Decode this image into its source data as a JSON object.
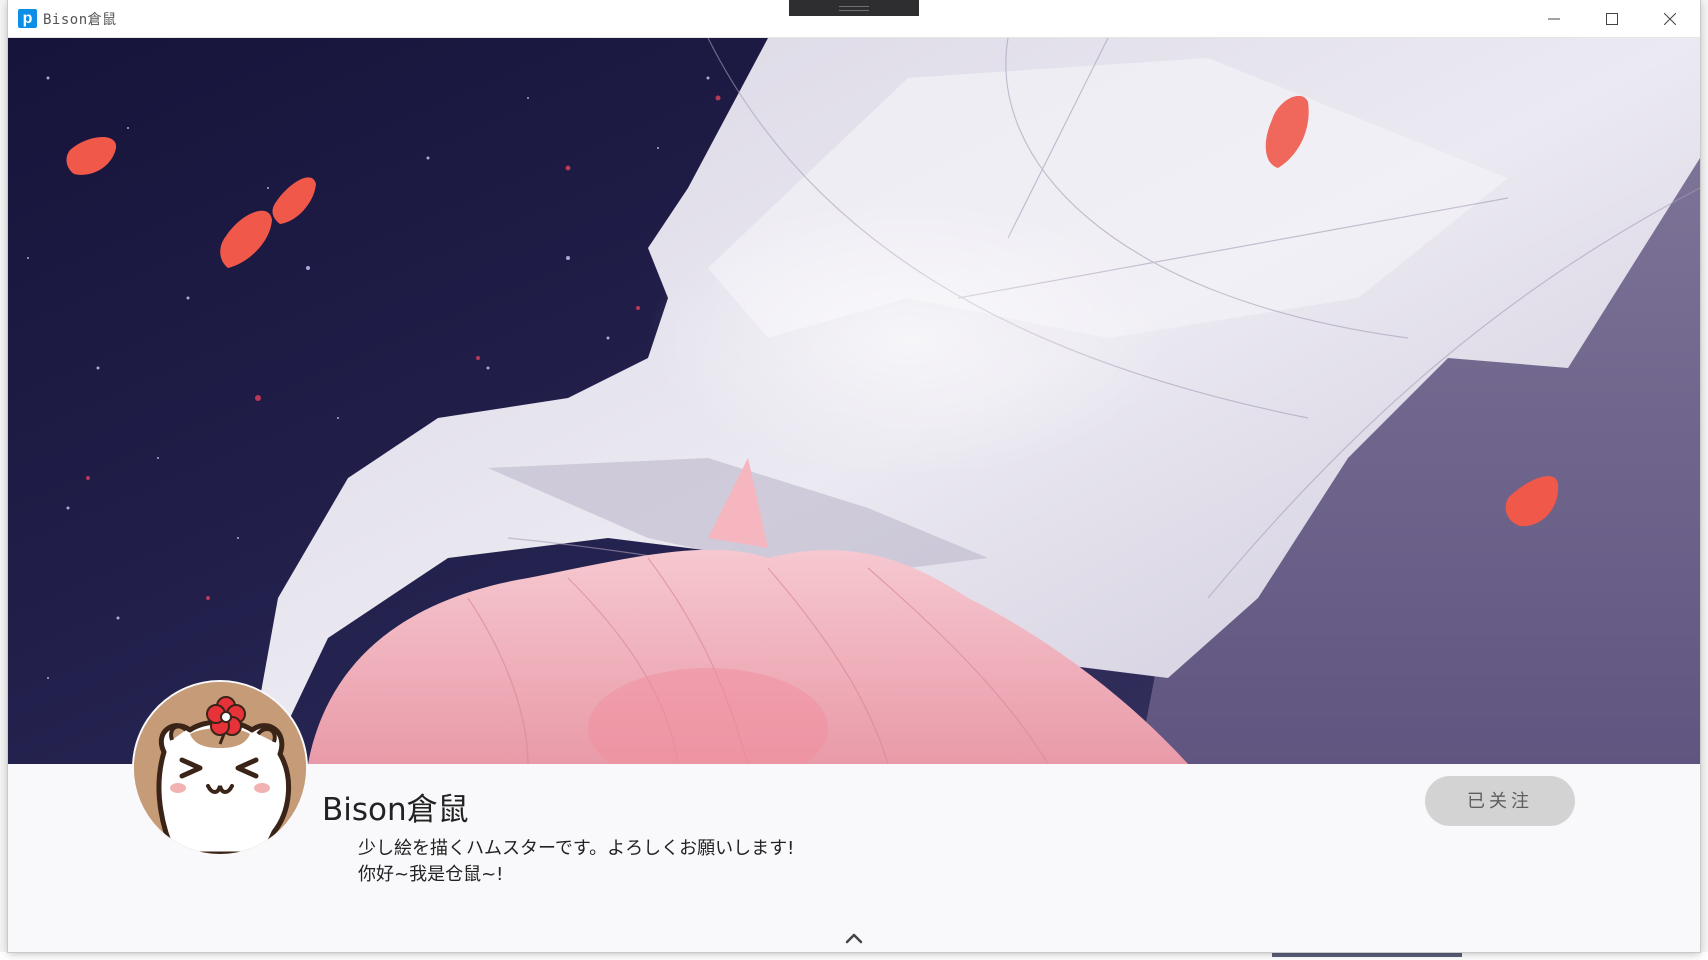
{
  "window": {
    "title": "Bison倉鼠",
    "app_icon_letter": "p",
    "controls": {
      "minimize_icon": "minimize-icon",
      "maximize_icon": "maximize-icon",
      "close_icon": "close-icon"
    }
  },
  "banner": {
    "description_icon": "banner-artwork",
    "colors": {
      "night_sky": "#1c1a40",
      "fabric": "#e6e4ee",
      "hair": "#f2b8c2",
      "petal": "#f0584a"
    }
  },
  "profile": {
    "username": "Bison倉鼠",
    "bio_lines": [
      "少し絵を描くハムスターです。よろしくお願いします!",
      "你好~我是仓鼠~!"
    ],
    "follow_button_label": "已关注",
    "collapse_icon": "chevron-up-icon"
  }
}
